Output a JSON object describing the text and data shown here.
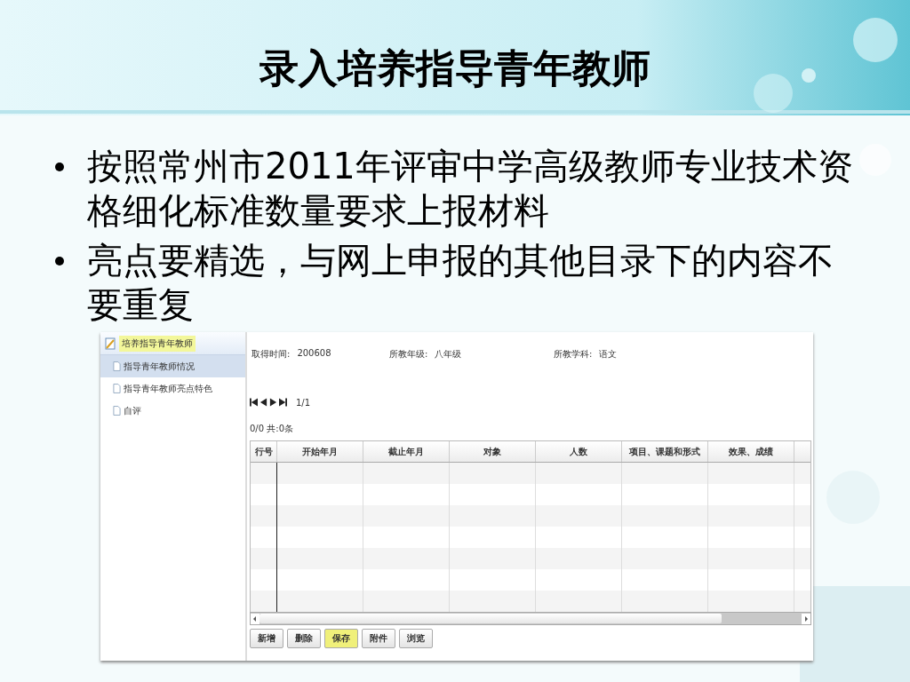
{
  "title": "录入培养指导青年教师",
  "bullets": [
    "按照常州市2011年评审中学高级教师专业技术资格细化标准数量要求上报材料",
    "亮点要精选，与网上申报的其他目录下的内容不要重复"
  ],
  "app": {
    "sidebar": {
      "header": "培养指导青年教师",
      "items": [
        {
          "label": "指导青年教师情况",
          "selected": true
        },
        {
          "label": "指导青年教师亮点特色",
          "selected": false
        },
        {
          "label": "自评",
          "selected": false
        }
      ]
    },
    "fields": [
      {
        "label": "取得时间:",
        "value": "200608"
      },
      {
        "label": "所教年级:",
        "value": "八年级"
      },
      {
        "label": "所教学科:",
        "value": "语文"
      }
    ],
    "pager": "1/1",
    "record_count": "0/0 共:0条",
    "table": {
      "columns": [
        "行号",
        "开始年月",
        "截止年月",
        "对象",
        "人数",
        "项目、课题和形式",
        "效果、成绩"
      ]
    },
    "buttons": [
      {
        "label": "新增",
        "selected": false
      },
      {
        "label": "删除",
        "selected": false
      },
      {
        "label": "保存",
        "selected": true
      },
      {
        "label": "附件",
        "selected": false
      },
      {
        "label": "浏览",
        "selected": false
      }
    ]
  }
}
